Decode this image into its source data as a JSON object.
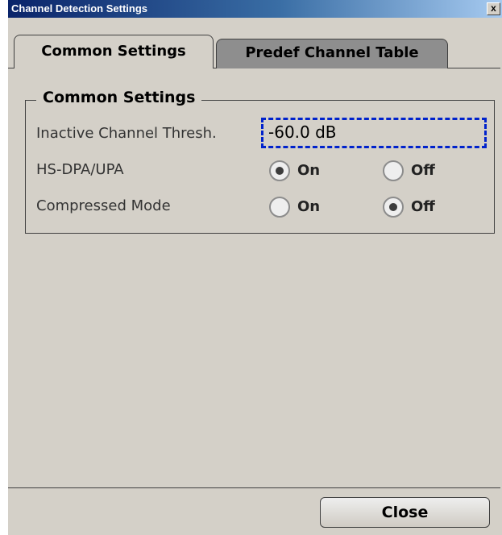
{
  "window": {
    "title": "Channel Detection Settings",
    "close_glyph": "x"
  },
  "tabs": [
    {
      "label": "Common Settings",
      "active": true
    },
    {
      "label": "Predef Channel Table",
      "active": false
    }
  ],
  "group": {
    "title": "Common Settings",
    "inactive_threshold": {
      "label": "Inactive Channel Thresh.",
      "value": "-60.0 dB"
    },
    "hsdpa": {
      "label": "HS-DPA/UPA",
      "on_label": "On",
      "off_label": "Off",
      "selected": "On"
    },
    "compressed": {
      "label": "Compressed Mode",
      "on_label": "On",
      "off_label": "Off",
      "selected": "Off"
    }
  },
  "footer": {
    "close_label": "Close"
  },
  "colors": {
    "focus_border": "#0022cc",
    "dialog_bg": "#d4d0c8",
    "inactive_tab": "#8e8e8e"
  }
}
